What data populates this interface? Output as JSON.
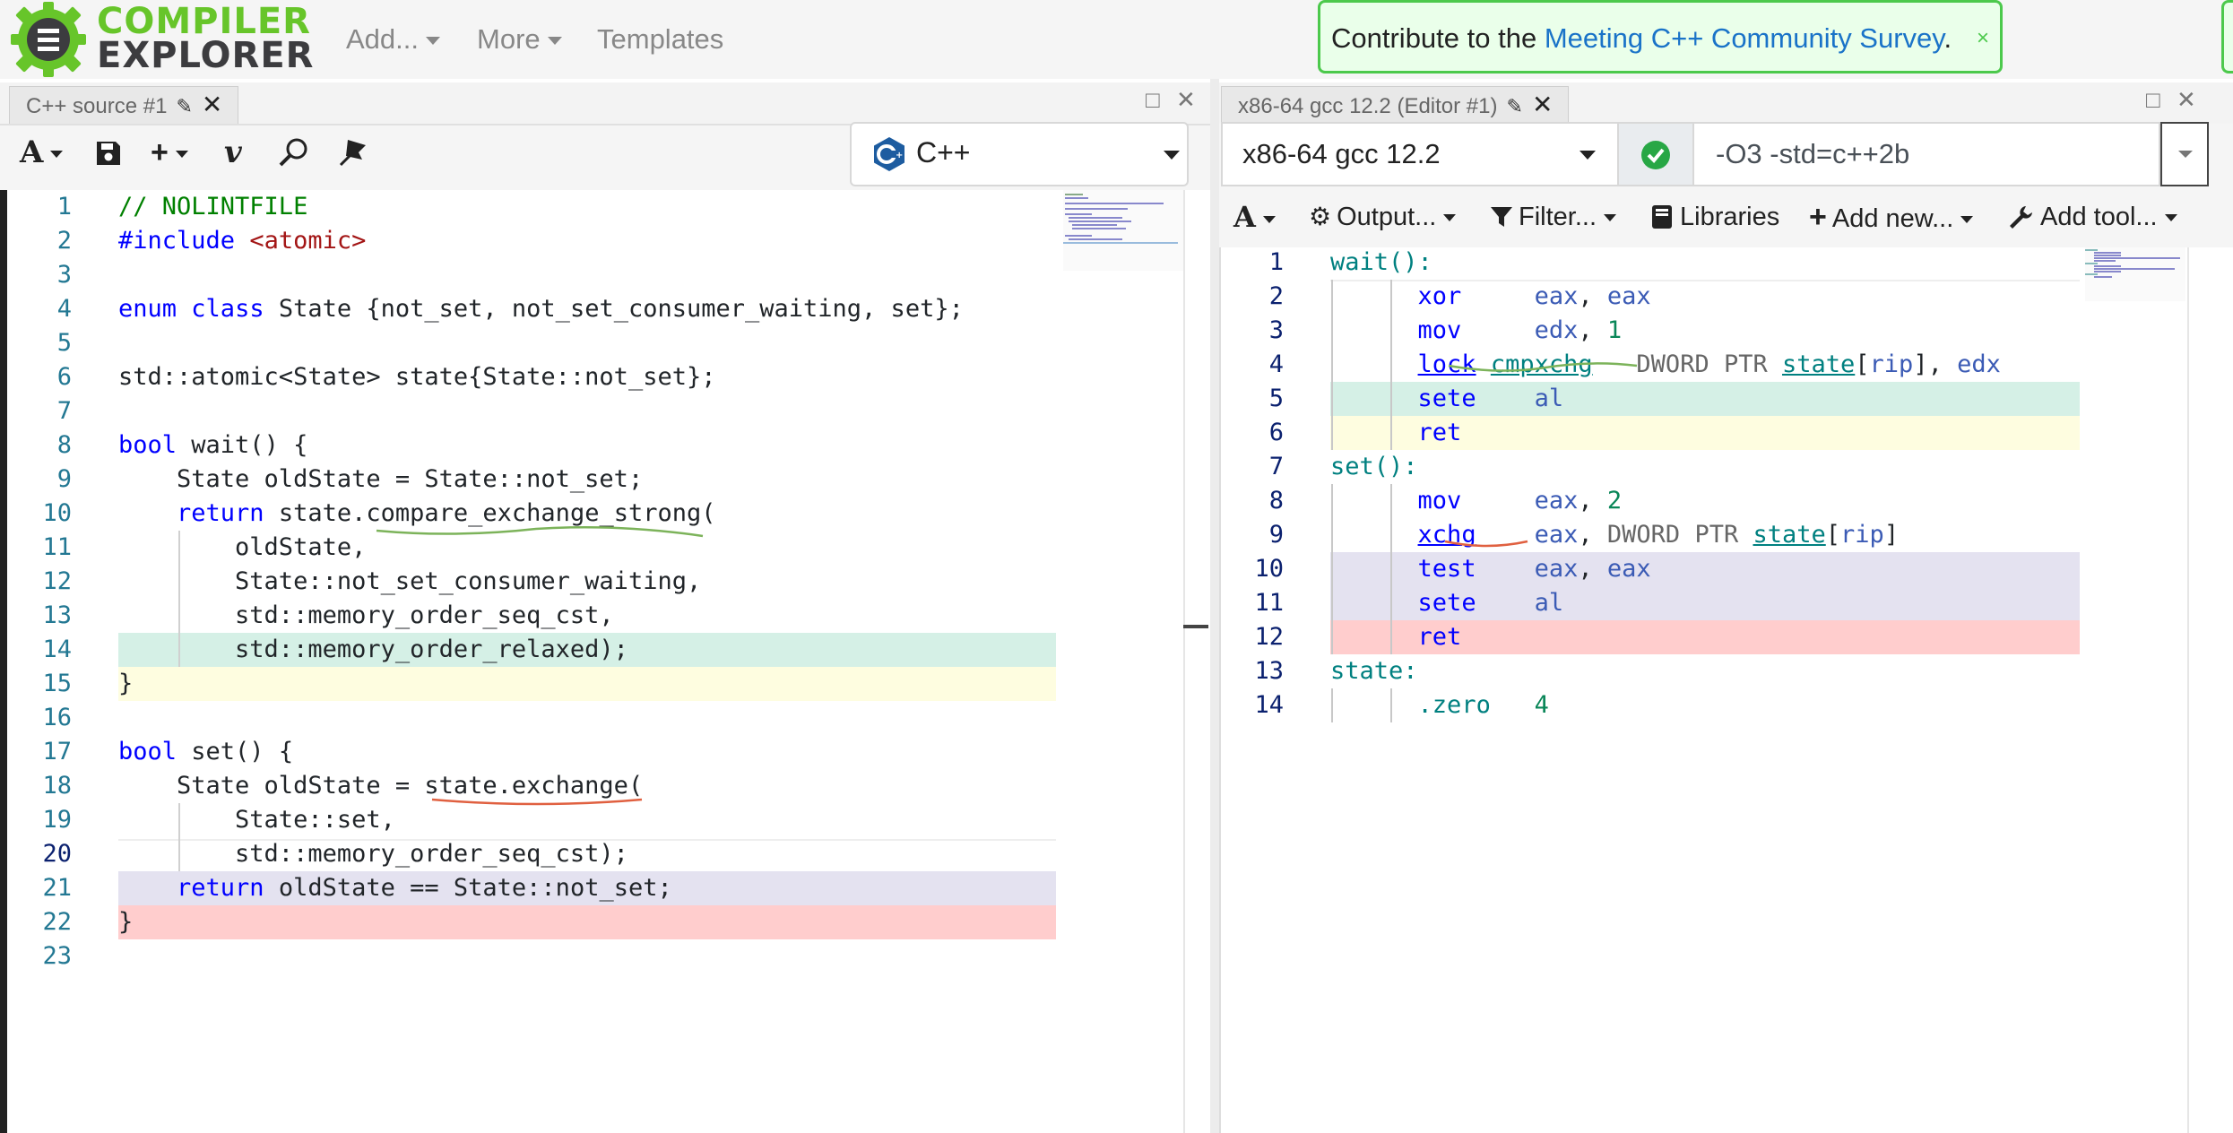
{
  "navbar": {
    "logo_line1": "COMPILER",
    "logo_line2": "EXPLORER",
    "add_label": "Add...",
    "more_label": "More",
    "templates_label": "Templates",
    "survey_prefix": "Contribute to the ",
    "survey_link": "Meeting C++ Community Survey",
    "survey_suffix": ".",
    "survey_close": "×"
  },
  "source_pane": {
    "tab_title": "C++ source #1",
    "language": "C++",
    "lines": [
      {
        "n": "1",
        "text": "// NOLINTFILE"
      },
      {
        "n": "2",
        "text": "#include <atomic>"
      },
      {
        "n": "3",
        "text": ""
      },
      {
        "n": "4",
        "text": "enum class State {not_set, not_set_consumer_waiting, set};"
      },
      {
        "n": "5",
        "text": ""
      },
      {
        "n": "6",
        "text": "std::atomic<State> state{State::not_set};"
      },
      {
        "n": "7",
        "text": ""
      },
      {
        "n": "8",
        "text": "bool wait() {"
      },
      {
        "n": "9",
        "text": "    State oldState = State::not_set;"
      },
      {
        "n": "10",
        "text": "    return state.compare_exchange_strong("
      },
      {
        "n": "11",
        "text": "        oldState,"
      },
      {
        "n": "12",
        "text": "        State::not_set_consumer_waiting,"
      },
      {
        "n": "13",
        "text": "        std::memory_order_seq_cst,"
      },
      {
        "n": "14",
        "text": "        std::memory_order_relaxed);"
      },
      {
        "n": "15",
        "text": "}"
      },
      {
        "n": "16",
        "text": ""
      },
      {
        "n": "17",
        "text": "bool set() {"
      },
      {
        "n": "18",
        "text": "    State oldState = state.exchange("
      },
      {
        "n": "19",
        "text": "        State::set,"
      },
      {
        "n": "20",
        "text": "        std::memory_order_seq_cst);"
      },
      {
        "n": "21",
        "text": "    return oldState == State::not_set;"
      },
      {
        "n": "22",
        "text": "}"
      },
      {
        "n": "23",
        "text": ""
      }
    ]
  },
  "asm_pane": {
    "tab_title": "x86-64 gcc 12.2 (Editor #1)",
    "compiler": "x86-64 gcc 12.2",
    "options": "-O3 -std=c++2b",
    "toolbar": {
      "output": "Output...",
      "filter": "Filter...",
      "libraries": "Libraries",
      "add_new": "Add new...",
      "add_tool": "Add tool..."
    },
    "lines": [
      {
        "n": "1",
        "label": "wait():"
      },
      {
        "n": "2",
        "op": "xor",
        "args": "eax, eax"
      },
      {
        "n": "3",
        "op": "mov",
        "args": "edx, 1"
      },
      {
        "n": "4",
        "op": "lock cmpxchg",
        "args": "DWORD PTR state[rip], edx"
      },
      {
        "n": "5",
        "op": "sete",
        "args": "al"
      },
      {
        "n": "6",
        "op": "ret",
        "args": ""
      },
      {
        "n": "7",
        "label": "set():"
      },
      {
        "n": "8",
        "op": "mov",
        "args": "eax, 2"
      },
      {
        "n": "9",
        "op": "xchg",
        "args": "eax, DWORD PTR state[rip]"
      },
      {
        "n": "10",
        "op": "test",
        "args": "eax, eax"
      },
      {
        "n": "11",
        "op": "sete",
        "args": "al"
      },
      {
        "n": "12",
        "op": "ret",
        "args": ""
      },
      {
        "n": "13",
        "label": "state:"
      },
      {
        "n": "14",
        "op": ".zero",
        "args": "4"
      }
    ]
  },
  "colors": {
    "highlight_green": "#d5f0e6",
    "highlight_yellow": "#fefde0",
    "highlight_purple": "#e4e2f0",
    "highlight_red": "#ffcdcd",
    "success_green": "#28a745",
    "logo_green": "#67c52a"
  }
}
